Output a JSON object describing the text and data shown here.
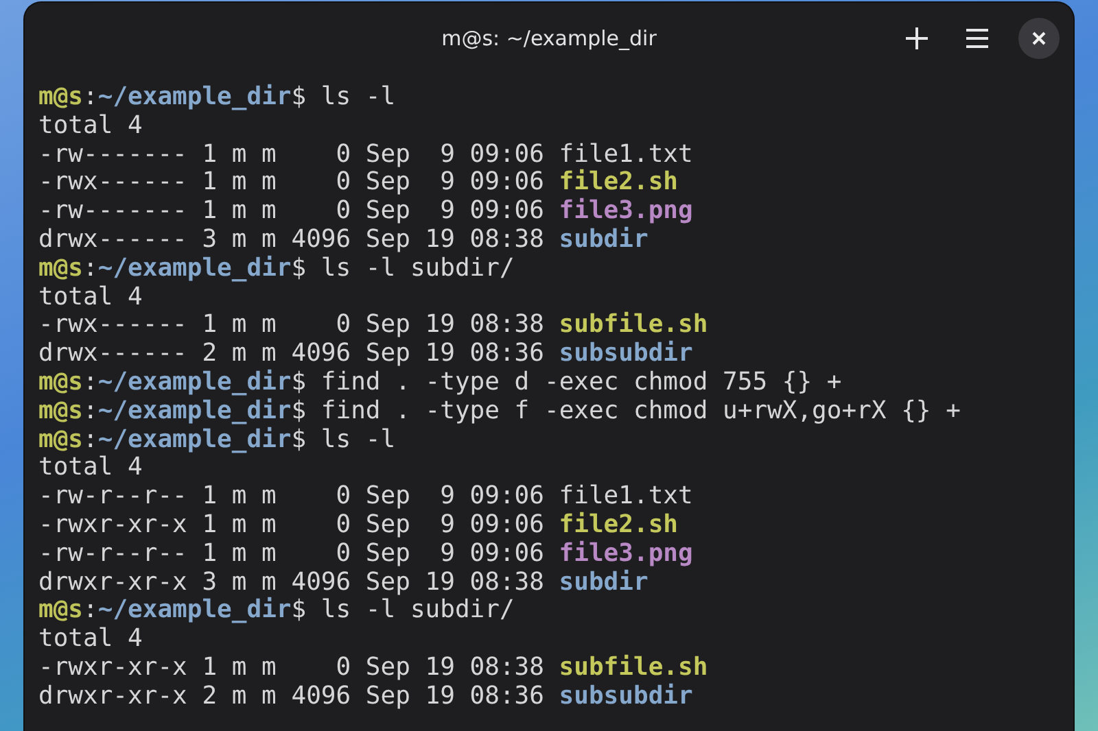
{
  "window": {
    "title": "m@s: ~/example_dir"
  },
  "terminal": {
    "lines": [
      {
        "segments": [
          {
            "text": "m@s",
            "kind": "user"
          },
          {
            "text": ":",
            "kind": "plain"
          },
          {
            "text": "~/example_dir",
            "kind": "path"
          },
          {
            "text": "$ ls -l",
            "kind": "plain"
          }
        ]
      },
      {
        "segments": [
          {
            "text": "total 4",
            "kind": "plain"
          }
        ]
      },
      {
        "segments": [
          {
            "text": "-rw------- 1 m m    0 Sep  9 09:06 file1.txt",
            "kind": "plain"
          }
        ]
      },
      {
        "segments": [
          {
            "text": "-rwx------ 1 m m    0 Sep  9 09:06 ",
            "kind": "plain"
          },
          {
            "text": "file2.sh",
            "kind": "exec"
          }
        ]
      },
      {
        "segments": [
          {
            "text": "-rw------- 1 m m    0 Sep  9 09:06 ",
            "kind": "plain"
          },
          {
            "text": "file3.png",
            "kind": "image"
          }
        ]
      },
      {
        "segments": [
          {
            "text": "drwx------ 3 m m 4096 Sep 19 08:38 ",
            "kind": "plain"
          },
          {
            "text": "subdir",
            "kind": "dir"
          }
        ]
      },
      {
        "segments": [
          {
            "text": "m@s",
            "kind": "user"
          },
          {
            "text": ":",
            "kind": "plain"
          },
          {
            "text": "~/example_dir",
            "kind": "path"
          },
          {
            "text": "$ ls -l subdir/",
            "kind": "plain"
          }
        ]
      },
      {
        "segments": [
          {
            "text": "total 4",
            "kind": "plain"
          }
        ]
      },
      {
        "segments": [
          {
            "text": "-rwx------ 1 m m    0 Sep 19 08:38 ",
            "kind": "plain"
          },
          {
            "text": "subfile.sh",
            "kind": "exec"
          }
        ]
      },
      {
        "segments": [
          {
            "text": "drwx------ 2 m m 4096 Sep 19 08:36 ",
            "kind": "plain"
          },
          {
            "text": "subsubdir",
            "kind": "dir"
          }
        ]
      },
      {
        "segments": [
          {
            "text": "m@s",
            "kind": "user"
          },
          {
            "text": ":",
            "kind": "plain"
          },
          {
            "text": "~/example_dir",
            "kind": "path"
          },
          {
            "text": "$ find . -type d -exec chmod 755 {} +",
            "kind": "plain"
          }
        ]
      },
      {
        "segments": [
          {
            "text": "m@s",
            "kind": "user"
          },
          {
            "text": ":",
            "kind": "plain"
          },
          {
            "text": "~/example_dir",
            "kind": "path"
          },
          {
            "text": "$ find . -type f -exec chmod u+rwX,go+rX {} +",
            "kind": "plain"
          }
        ]
      },
      {
        "segments": [
          {
            "text": "m@s",
            "kind": "user"
          },
          {
            "text": ":",
            "kind": "plain"
          },
          {
            "text": "~/example_dir",
            "kind": "path"
          },
          {
            "text": "$ ls -l",
            "kind": "plain"
          }
        ]
      },
      {
        "segments": [
          {
            "text": "total 4",
            "kind": "plain"
          }
        ]
      },
      {
        "segments": [
          {
            "text": "-rw-r--r-- 1 m m    0 Sep  9 09:06 file1.txt",
            "kind": "plain"
          }
        ]
      },
      {
        "segments": [
          {
            "text": "-rwxr-xr-x 1 m m    0 Sep  9 09:06 ",
            "kind": "plain"
          },
          {
            "text": "file2.sh",
            "kind": "exec"
          }
        ]
      },
      {
        "segments": [
          {
            "text": "-rw-r--r-- 1 m m    0 Sep  9 09:06 ",
            "kind": "plain"
          },
          {
            "text": "file3.png",
            "kind": "image"
          }
        ]
      },
      {
        "segments": [
          {
            "text": "drwxr-xr-x 3 m m 4096 Sep 19 08:38 ",
            "kind": "plain"
          },
          {
            "text": "subdir",
            "kind": "dir"
          }
        ]
      },
      {
        "segments": [
          {
            "text": "m@s",
            "kind": "user"
          },
          {
            "text": ":",
            "kind": "plain"
          },
          {
            "text": "~/example_dir",
            "kind": "path"
          },
          {
            "text": "$ ls -l subdir/",
            "kind": "plain"
          }
        ]
      },
      {
        "segments": [
          {
            "text": "total 4",
            "kind": "plain"
          }
        ]
      },
      {
        "segments": [
          {
            "text": "-rwxr-xr-x 1 m m    0 Sep 19 08:38 ",
            "kind": "plain"
          },
          {
            "text": "subfile.sh",
            "kind": "exec"
          }
        ]
      },
      {
        "segments": [
          {
            "text": "drwxr-xr-x 2 m m 4096 Sep 19 08:36 ",
            "kind": "plain"
          },
          {
            "text": "subsubdir",
            "kind": "dir"
          }
        ]
      }
    ]
  }
}
